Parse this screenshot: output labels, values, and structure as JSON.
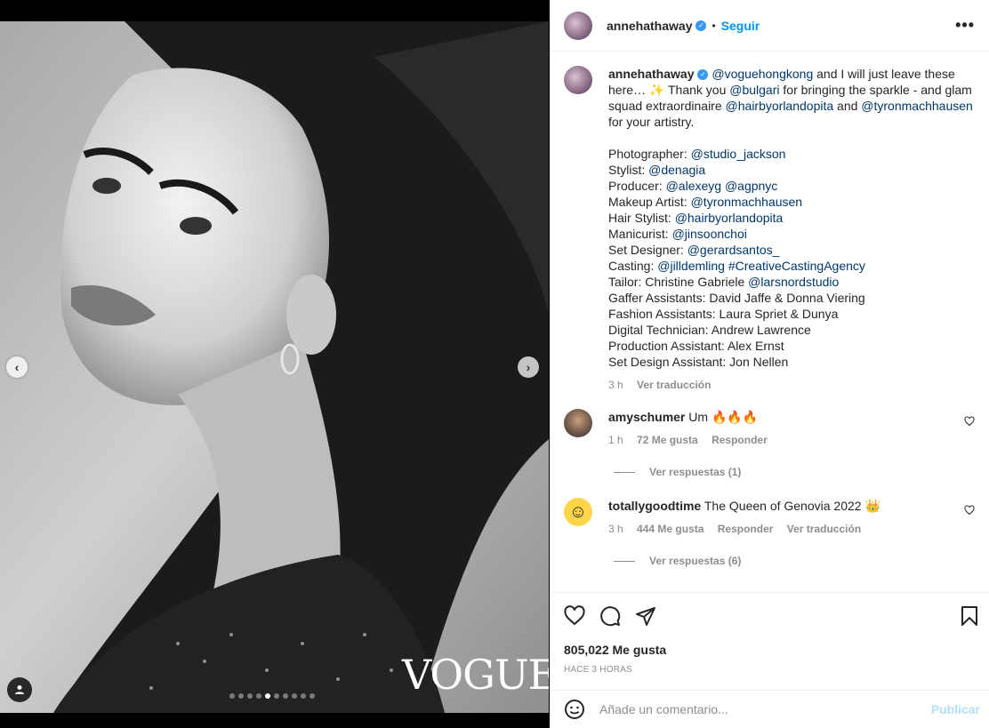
{
  "post": {
    "username": "annehathaway",
    "verified_mark": "✓",
    "bullet": "•",
    "follow_label": "Seguir",
    "more_label": "•••"
  },
  "media": {
    "watermark": "VOGUE",
    "dot_count": 10,
    "active_dot": 4
  },
  "caption": {
    "username": "annehathaway",
    "segments": [
      {
        "t": "@voguehongkong",
        "m": true
      },
      {
        "t": " and I will just leave these here… ✨ Thank you ",
        "m": false
      },
      {
        "t": "@bulgari",
        "m": true
      },
      {
        "t": " for bringing the sparkle - and glam squad extraordinaire ",
        "m": false
      },
      {
        "t": "@hairbyorlandopita",
        "m": true
      },
      {
        "t": " and ",
        "m": false
      },
      {
        "t": "@tyronmachhausen",
        "m": true
      },
      {
        "t": " for your artistry.",
        "m": false
      }
    ],
    "credits": [
      [
        {
          "t": "Photographer: ",
          "m": false
        },
        {
          "t": "@studio_jackson",
          "m": true
        }
      ],
      [
        {
          "t": "Stylist: ",
          "m": false
        },
        {
          "t": "@denagia",
          "m": true
        }
      ],
      [
        {
          "t": "Producer: ",
          "m": false
        },
        {
          "t": "@alexeyg",
          "m": true
        },
        {
          "t": " ",
          "m": false
        },
        {
          "t": "@agpnyc",
          "m": true
        }
      ],
      [
        {
          "t": "Makeup Artist: ",
          "m": false
        },
        {
          "t": "@tyronmachhausen",
          "m": true
        }
      ],
      [
        {
          "t": "Hair Stylist: ",
          "m": false
        },
        {
          "t": "@hairbyorlandopita",
          "m": true
        }
      ],
      [
        {
          "t": "Manicurist: ",
          "m": false
        },
        {
          "t": "@jinsoonchoi",
          "m": true
        }
      ],
      [
        {
          "t": "Set Designer: ",
          "m": false
        },
        {
          "t": "@gerardsantos_",
          "m": true
        }
      ],
      [
        {
          "t": "Casting: ",
          "m": false
        },
        {
          "t": "@jilldemling",
          "m": true
        },
        {
          "t": " ",
          "m": false
        },
        {
          "t": "#CreativeCastingAgency",
          "m": true
        }
      ],
      [
        {
          "t": "Tailor: Christine Gabriele ",
          "m": false
        },
        {
          "t": "@larsnordstudio",
          "m": true
        }
      ],
      [
        {
          "t": "Gaffer Assistants: David Jaffe & Donna Viering",
          "m": false
        }
      ],
      [
        {
          "t": "Fashion Assistants: Laura Spriet & Dunya",
          "m": false
        }
      ],
      [
        {
          "t": "Digital Technician: Andrew Lawrence",
          "m": false
        }
      ],
      [
        {
          "t": "Production Assistant: Alex Ernst",
          "m": false
        }
      ],
      [
        {
          "t": "Set Design Assistant: Jon Nellen",
          "m": false
        }
      ]
    ],
    "time": "3 h",
    "translate": "Ver traducción"
  },
  "comments": [
    {
      "username": "amyschumer",
      "text": "Um 🔥🔥🔥",
      "time": "1 h",
      "likes": "72 Me gusta",
      "reply": "Responder",
      "translate": "",
      "view_replies": "Ver respuestas (1)"
    },
    {
      "username": "totallygoodtime",
      "text": "The Queen of Genovia 2022 👑",
      "time": "3 h",
      "likes": "444 Me gusta",
      "reply": "Responder",
      "translate": "Ver traducción",
      "view_replies": "Ver respuestas (6)"
    }
  ],
  "actions": {
    "likes": "805,022 Me gusta",
    "ago": "HACE 3 HORAS"
  },
  "add_comment": {
    "placeholder": "Añade un comentario...",
    "post_label": "Publicar"
  },
  "colors": {
    "accent": "#0095f6",
    "mention": "#00376b",
    "muted": "#8e8e8e"
  }
}
